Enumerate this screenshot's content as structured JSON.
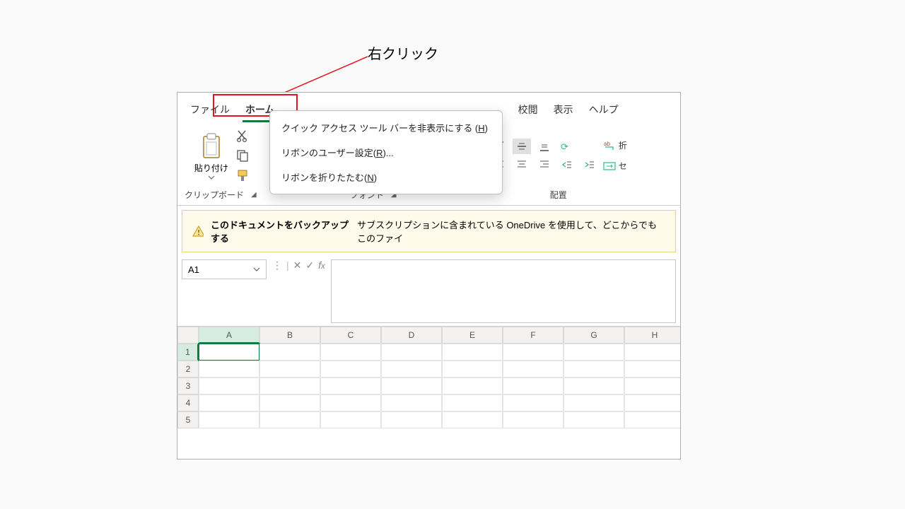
{
  "annotation": {
    "label": "右クリック"
  },
  "tabs": {
    "file": "ファイル",
    "home": "ホーム",
    "review": "校閲",
    "view": "表示",
    "help": "ヘルプ"
  },
  "context_menu": {
    "hide_qat_pre": "クイック アクセス ツール バーを非表示にする (",
    "hide_qat_key": "H",
    "hide_qat_post": ")",
    "customize_pre": "リボンのユーザー設定(",
    "customize_key": "R",
    "customize_post": ")...",
    "collapse_pre": "リボンを折りたたむ(",
    "collapse_key": "N",
    "collapse_post": ")"
  },
  "ribbon": {
    "paste": "貼り付け",
    "clipboard_label": "クリップボード",
    "font_label": "フォント",
    "align_label": "配置",
    "wrap": "折",
    "merge": "セ"
  },
  "messagebar": {
    "bold": "このドキュメントをバックアップする",
    "text": "サブスクリプションに含まれている OneDrive を使用して、どこからでもこのファイ"
  },
  "namebox": {
    "value": "A1"
  },
  "columns": [
    "A",
    "B",
    "C",
    "D",
    "E",
    "F",
    "G",
    "H"
  ],
  "rows": [
    "1",
    "2",
    "3",
    "4",
    "5"
  ]
}
